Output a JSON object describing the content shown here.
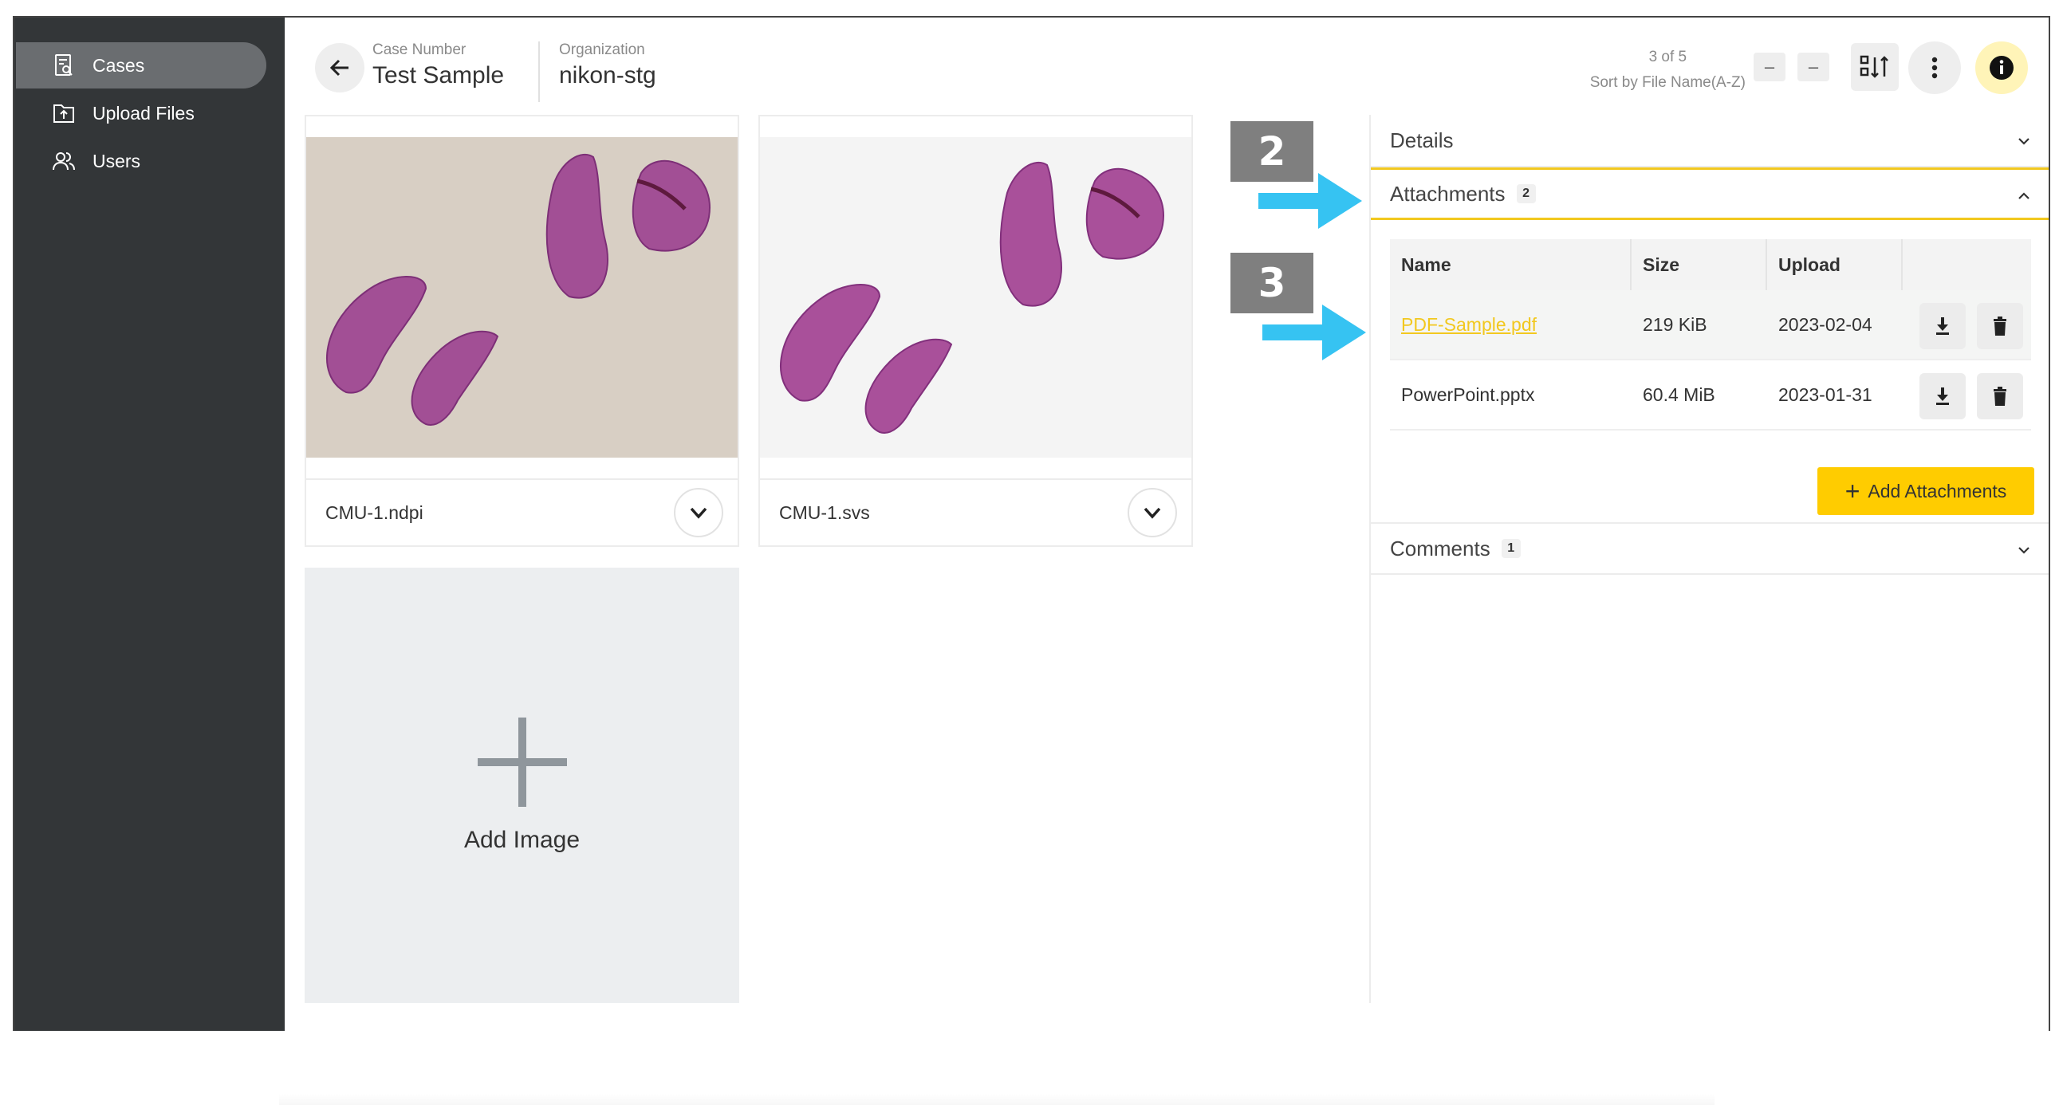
{
  "sidebar": {
    "items": [
      {
        "label": "Cases",
        "icon": "cases-icon",
        "active": true
      },
      {
        "label": "Upload Files",
        "icon": "upload-icon",
        "active": false
      },
      {
        "label": "Users",
        "icon": "users-icon",
        "active": false
      }
    ]
  },
  "header": {
    "case_number_label": "Case Number",
    "case_number": "Test Sample",
    "organization_label": "Organization",
    "organization": "nikon-stg",
    "pager_count": "3 of 5",
    "sort_label": "Sort by File Name(A-Z)",
    "minus_1": "–",
    "minus_2": "–"
  },
  "images": [
    {
      "file_name": "CMU-1.ndpi",
      "background": "#d8cfc4"
    },
    {
      "file_name": "CMU-1.svs",
      "background": "#f4f4f4"
    }
  ],
  "add_image": {
    "label": "Add Image"
  },
  "panel": {
    "details": {
      "label": "Details"
    },
    "attachments": {
      "label": "Attachments",
      "count": "2",
      "columns": {
        "name": "Name",
        "size": "Size",
        "upload": "Upload"
      },
      "rows": [
        {
          "name": "PDF-Sample.pdf",
          "size": "219 KiB",
          "upload": "2023-02-04"
        },
        {
          "name": "PowerPoint.pptx",
          "size": "60.4 MiB",
          "upload": "2023-01-31"
        }
      ],
      "add_button": "Add Attachments"
    },
    "comments": {
      "label": "Comments",
      "count": "1"
    }
  },
  "callouts": {
    "two": "2",
    "three": "3"
  },
  "colors": {
    "accent": "#ffcc00",
    "sidebar": "#333638",
    "arrow": "#36c3f2",
    "link": "#f2c81f"
  }
}
